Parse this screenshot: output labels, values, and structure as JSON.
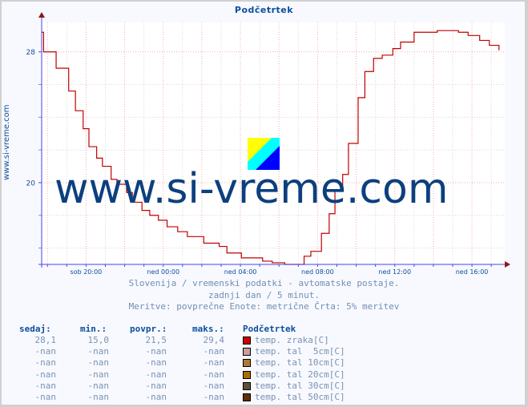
{
  "chart_data": {
    "type": "line",
    "title": "Podčetrtek",
    "ylabel": "www.si-vreme.com",
    "xlabel": "",
    "x_unit": "hours relative to sob 20:00",
    "xlim": [
      -2.3,
      21.7
    ],
    "ylim": [
      15.0,
      29.8
    ],
    "yticks": [
      {
        "value": 28,
        "label": "28"
      },
      {
        "value": 20,
        "label": "20"
      }
    ],
    "ygrid_minor": [
      16,
      18,
      22,
      24,
      26
    ],
    "xticks": [
      {
        "value": 0,
        "label": "sob 20:00"
      },
      {
        "value": 4,
        "label": "ned 00:00"
      },
      {
        "value": 8,
        "label": "ned 04:00"
      },
      {
        "value": 12,
        "label": "ned 08:00"
      },
      {
        "value": 16,
        "label": "ned 12:00"
      },
      {
        "value": 20,
        "label": "ned 16:00"
      }
    ],
    "grid": true,
    "reference_line": {
      "value": 15.1,
      "style": "dashed",
      "color": "#c00000"
    },
    "series": [
      {
        "name": "temp. zraka[C]",
        "color": "#c00000",
        "step": true,
        "x": [
          -2.3,
          -2.2,
          -1.7,
          -1.55,
          -1.1,
          -0.9,
          -0.55,
          -0.15,
          0.15,
          0.55,
          0.85,
          1.3,
          1.6,
          2.1,
          2.4,
          2.9,
          3.3,
          3.75,
          4.2,
          4.75,
          5.25,
          5.7,
          6.1,
          6.9,
          7.3,
          8.05,
          8.5,
          9.15,
          9.65,
          10.3,
          10.8,
          11.3,
          11.65,
          12.2,
          12.6,
          12.9,
          13.3,
          13.6,
          14.1,
          14.45,
          14.9,
          15.35,
          15.9,
          16.3,
          17.0,
          17.4,
          18.2,
          18.8,
          19.3,
          19.8,
          20.4,
          20.9,
          21.4
        ],
        "y": [
          29.2,
          28.0,
          28.0,
          27.0,
          27.0,
          25.6,
          24.4,
          23.3,
          22.2,
          21.5,
          21.0,
          20.2,
          19.9,
          19.4,
          18.8,
          18.3,
          18.0,
          17.7,
          17.3,
          17.0,
          16.7,
          16.7,
          16.3,
          16.1,
          15.7,
          15.4,
          15.4,
          15.2,
          15.1,
          15.0,
          15.0,
          15.5,
          15.8,
          16.9,
          18.1,
          19.5,
          20.5,
          22.4,
          25.2,
          26.8,
          27.6,
          27.8,
          28.2,
          28.6,
          29.2,
          29.2,
          29.3,
          29.3,
          29.2,
          29.0,
          28.7,
          28.4,
          28.1
        ]
      }
    ],
    "logo_colors": [
      "#ffff00",
      "#00ffff",
      "#0000ff"
    ]
  },
  "footer": {
    "line1": "Slovenija / vremenski podatki - avtomatske postaje.",
    "line2": "zadnji dan / 5 minut.",
    "line3": "Meritve: povprečne  Enote: metrične  Črta: 5% meritev"
  },
  "watermark": "www.si-vreme.com",
  "stats": {
    "headers": {
      "now": "sedaj:",
      "min": "min.:",
      "avg": "povpr.:",
      "max": "maks.:",
      "station": "Podčetrtek"
    },
    "rows": [
      {
        "now": "28,1",
        "min": "15,0",
        "avg": "21,5",
        "max": "29,4",
        "label": "temp. zraka[C]",
        "color": "#cc0000"
      },
      {
        "now": "-nan",
        "min": "-nan",
        "avg": "-nan",
        "max": "-nan",
        "label": "temp. tal  5cm[C]",
        "color": "#c8a0a0"
      },
      {
        "now": "-nan",
        "min": "-nan",
        "avg": "-nan",
        "max": "-nan",
        "label": "temp. tal 10cm[C]",
        "color": "#b07838"
      },
      {
        "now": "-nan",
        "min": "-nan",
        "avg": "-nan",
        "max": "-nan",
        "label": "temp. tal 20cm[C]",
        "color": "#a87000"
      },
      {
        "now": "-nan",
        "min": "-nan",
        "avg": "-nan",
        "max": "-nan",
        "label": "temp. tal 30cm[C]",
        "color": "#5c5038"
      },
      {
        "now": "-nan",
        "min": "-nan",
        "avg": "-nan",
        "max": "-nan",
        "label": "temp. tal 50cm[C]",
        "color": "#603008"
      }
    ]
  }
}
